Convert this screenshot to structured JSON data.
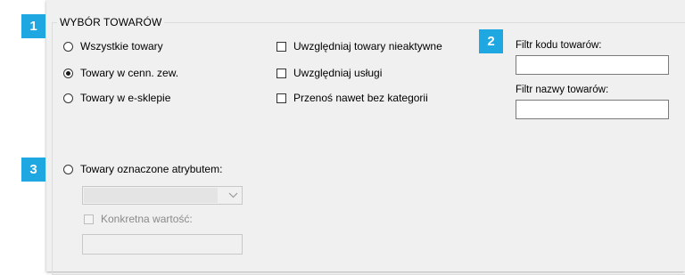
{
  "group_title": "WYBÓR TOWARÓW",
  "badges": [
    "1",
    "2",
    "3"
  ],
  "radios": [
    {
      "label": "Wszystkie towary",
      "checked": false
    },
    {
      "label": "Towary w cenn. zew.",
      "checked": true
    },
    {
      "label": "Towary w e-sklepie",
      "checked": false
    },
    {
      "label": "Towary oznaczone atrybutem:",
      "checked": false
    }
  ],
  "checkboxes": [
    {
      "label": "Uwzględniaj towary nieaktywne",
      "checked": false
    },
    {
      "label": "Uwzględniaj usługi",
      "checked": false
    },
    {
      "label": "Przenoś nawet bez kategorii",
      "checked": false
    }
  ],
  "filters": {
    "code_label": "Filtr kodu towarów:",
    "code_value": "",
    "name_label": "Filtr nazwy towarów:",
    "name_value": ""
  },
  "attribute": {
    "combo_value": "",
    "specific_value_label": "Konkretna wartość:",
    "specific_value": ""
  },
  "icons": {
    "combo_arrow": "chevron-down-icon"
  },
  "colors": {
    "badge": "#1ea7e1",
    "panel": "#f0f0f0"
  }
}
